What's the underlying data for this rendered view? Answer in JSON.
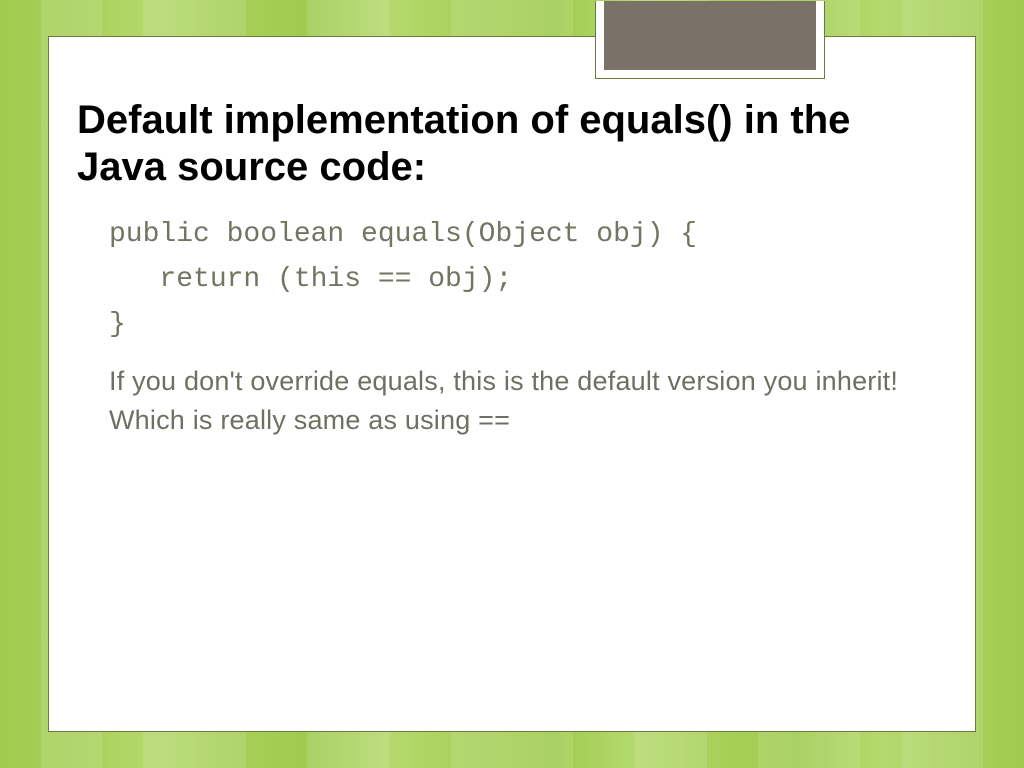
{
  "slide": {
    "title": "Default implementation of equals() in the Java source code:",
    "code": "public boolean equals(Object obj) {\n   return (this == obj);\n}",
    "explanation": "If you don't override equals, this is the default version you inherit!  Which is really same as using =="
  },
  "colors": {
    "accent_green": "#9fcb4f",
    "tab_fill": "#7a7268",
    "border": "#6a7a3a",
    "body_text": "#6f6f63"
  }
}
